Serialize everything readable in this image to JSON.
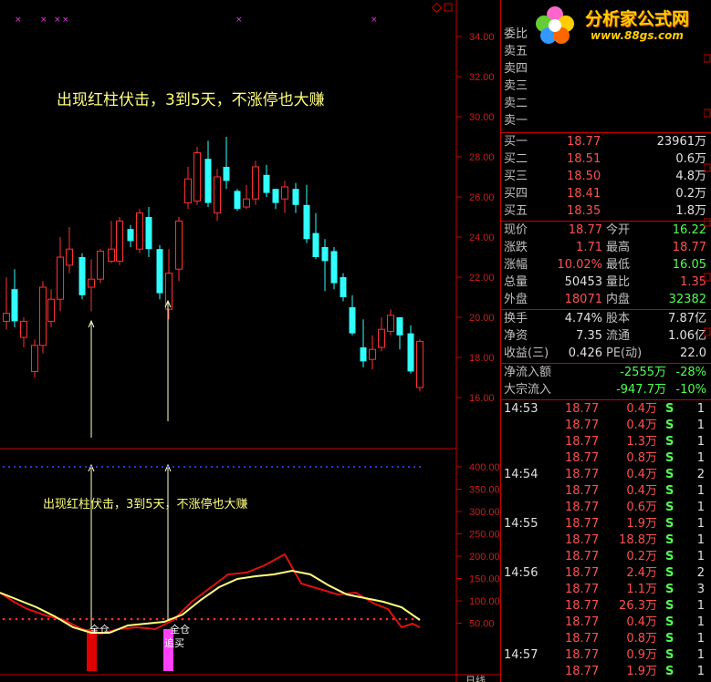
{
  "main_chart": {
    "annotation": "出现红柱伏击，3到5天，不涨停也大赚",
    "y_ticks": [
      "34.00",
      "32.00",
      "30.00",
      "28.00",
      "26.00",
      "24.00",
      "22.00",
      "20.00",
      "18.00",
      "16.00"
    ]
  },
  "sub_chart": {
    "annotation": "出现红柱伏击，3到5天，不涨停也大赚",
    "y_ticks": [
      "400.00",
      "350.00",
      "300.00",
      "250.00",
      "200.00",
      "150.00",
      "100.00",
      "50.00"
    ],
    "signal_1": "全仓",
    "signal_2_line1": "全仓",
    "signal_2_line2": "追买"
  },
  "bottom_label": "日线",
  "logo": {
    "text": "分析家公式网",
    "url": "www.88gs.com"
  },
  "order_book": {
    "weibi_label": "委比",
    "asks": [
      {
        "label": "卖五"
      },
      {
        "label": "卖四"
      },
      {
        "label": "卖三"
      },
      {
        "label": "卖二"
      },
      {
        "label": "卖一"
      }
    ],
    "bids": [
      {
        "label": "买一",
        "price": "18.77",
        "vol": "23961万"
      },
      {
        "label": "买二",
        "price": "18.51",
        "vol": "0.6万"
      },
      {
        "label": "买三",
        "price": "18.50",
        "vol": "4.8万"
      },
      {
        "label": "买四",
        "price": "18.41",
        "vol": "0.2万"
      },
      {
        "label": "买五",
        "price": "18.35",
        "vol": "1.8万"
      }
    ]
  },
  "quote": [
    {
      "l1": "现价",
      "v1": "18.77",
      "c1": "red",
      "l2": "今开",
      "v2": "16.22",
      "c2": "green"
    },
    {
      "l1": "涨跌",
      "v1": "1.71",
      "c1": "red",
      "l2": "最高",
      "v2": "18.77",
      "c2": "red"
    },
    {
      "l1": "涨幅",
      "v1": "10.02%",
      "c1": "red",
      "l2": "最低",
      "v2": "16.05",
      "c2": "green"
    },
    {
      "l1": "总量",
      "v1": "50453",
      "c1": "white",
      "l2": "量比",
      "v2": "1.35",
      "c2": "red"
    },
    {
      "l1": "外盘",
      "v1": "18071",
      "c1": "red",
      "l2": "内盘",
      "v2": "32382",
      "c2": "green"
    }
  ],
  "fundamentals": [
    {
      "l1": "换手",
      "v1": "4.74%",
      "l2": "股本",
      "v2": "7.87亿"
    },
    {
      "l1": "净资",
      "v1": "7.35",
      "l2": "流通",
      "v2": "1.06亿"
    },
    {
      "l1": "收益(三)",
      "v1": "0.426",
      "l2": "PE(动)",
      "v2": "22.0"
    }
  ],
  "flows": [
    {
      "label": "净流入额",
      "v": "-2555万",
      "pct": "-28%"
    },
    {
      "label": "大宗流入",
      "v": "-947.7万",
      "pct": "-10%"
    }
  ],
  "ticks": [
    {
      "time": "14:53",
      "price": "18.77",
      "vol": "0.4万",
      "side": "S",
      "cnt": "1"
    },
    {
      "time": "",
      "price": "18.77",
      "vol": "0.4万",
      "side": "S",
      "cnt": "1"
    },
    {
      "time": "",
      "price": "18.77",
      "vol": "1.3万",
      "side": "S",
      "cnt": "1"
    },
    {
      "time": "",
      "price": "18.77",
      "vol": "0.8万",
      "side": "S",
      "cnt": "1"
    },
    {
      "time": "14:54",
      "price": "18.77",
      "vol": "0.4万",
      "side": "S",
      "cnt": "2"
    },
    {
      "time": "",
      "price": "18.77",
      "vol": "0.4万",
      "side": "S",
      "cnt": "1"
    },
    {
      "time": "",
      "price": "18.77",
      "vol": "0.6万",
      "side": "S",
      "cnt": "1"
    },
    {
      "time": "14:55",
      "price": "18.77",
      "vol": "1.9万",
      "side": "S",
      "cnt": "1"
    },
    {
      "time": "",
      "price": "18.77",
      "vol": "18.8万",
      "side": "S",
      "cnt": "1"
    },
    {
      "time": "",
      "price": "18.77",
      "vol": "0.2万",
      "side": "S",
      "cnt": "1"
    },
    {
      "time": "14:56",
      "price": "18.77",
      "vol": "2.4万",
      "side": "S",
      "cnt": "2"
    },
    {
      "time": "",
      "price": "18.77",
      "vol": "1.1万",
      "side": "S",
      "cnt": "3"
    },
    {
      "time": "",
      "price": "18.77",
      "vol": "26.3万",
      "side": "S",
      "cnt": "1"
    },
    {
      "time": "",
      "price": "18.77",
      "vol": "0.4万",
      "side": "S",
      "cnt": "1"
    },
    {
      "time": "",
      "price": "18.77",
      "vol": "0.8万",
      "side": "S",
      "cnt": "1"
    },
    {
      "time": "14:57",
      "price": "18.77",
      "vol": "0.9万",
      "side": "S",
      "cnt": "1"
    },
    {
      "time": "",
      "price": "18.77",
      "vol": "1.9万",
      "side": "S",
      "cnt": "1"
    }
  ],
  "colors": {
    "up": "#ff3030",
    "down": "#30ffff",
    "border": "#c80000",
    "ma": "#ffff80",
    "line2": "#e01010"
  }
}
